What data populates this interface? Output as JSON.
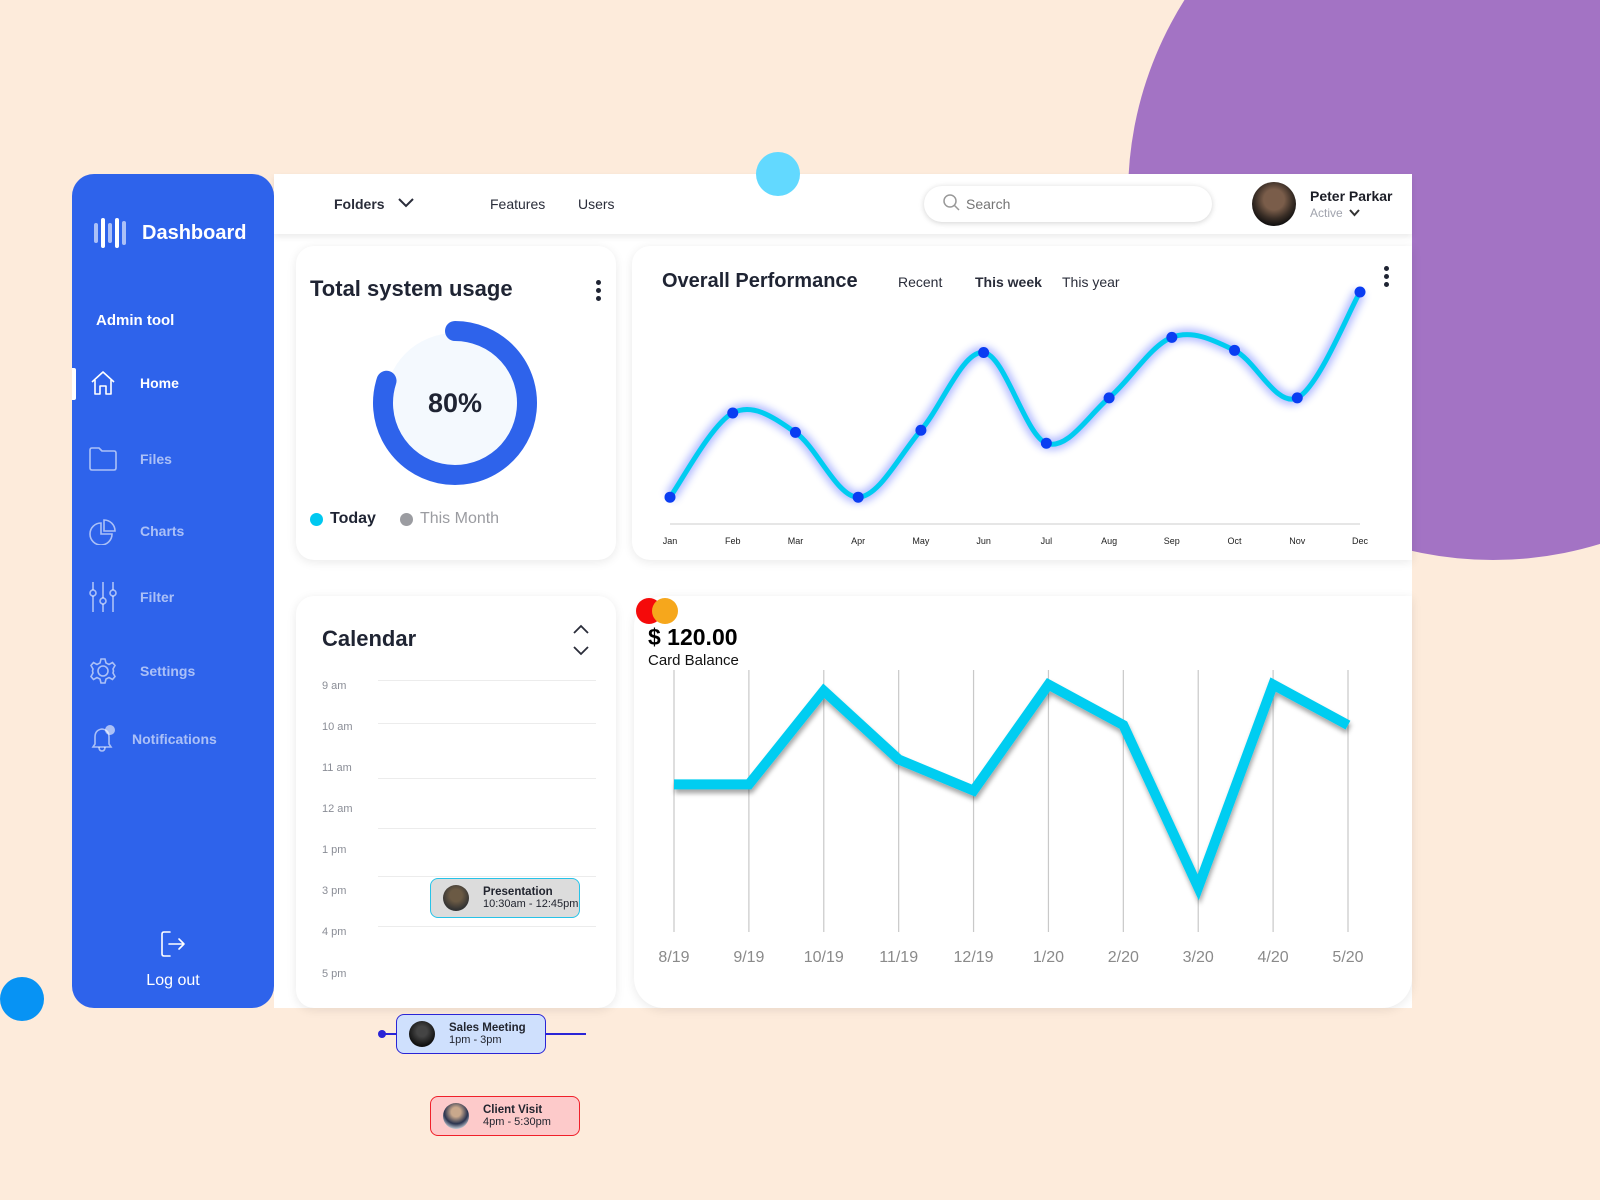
{
  "sidebar": {
    "brand_title": "Dashboard",
    "section_label": "Admin tool",
    "items": [
      {
        "label": "Home",
        "icon": "home-icon",
        "active": true
      },
      {
        "label": "Files",
        "icon": "folder-icon",
        "active": false
      },
      {
        "label": "Charts",
        "icon": "pie-chart-icon",
        "active": false
      },
      {
        "label": "Filter",
        "icon": "sliders-icon",
        "active": false
      },
      {
        "label": "Settings",
        "icon": "gear-icon",
        "active": false
      },
      {
        "label": "Notifications",
        "icon": "bell-icon",
        "active": false
      }
    ],
    "logout_label": "Log out"
  },
  "topbar": {
    "folders_label": "Folders",
    "features_label": "Features",
    "users_label": "Users",
    "search_placeholder": "Search",
    "search_value": "",
    "user_name": "Peter Parkar",
    "user_status": "Active"
  },
  "usage": {
    "title": "Total system usage",
    "percent_label": "80%",
    "percent": 80,
    "legend": [
      {
        "label": "Today",
        "color": "#00c8f0"
      },
      {
        "label": "This Month",
        "color": "#9b9ca1"
      }
    ]
  },
  "performance": {
    "title": "Overall Performance",
    "tabs": [
      {
        "label": "Recent",
        "active": false
      },
      {
        "label": "This week",
        "active": true
      },
      {
        "label": "This year",
        "active": false
      }
    ]
  },
  "calendar": {
    "title": "Calendar",
    "hours": [
      "9 am",
      "10 am",
      "11 am",
      "12 am",
      "1 pm",
      "3 pm",
      "4 pm",
      "5 pm"
    ],
    "events": [
      {
        "title": "Presentation",
        "time": "10:30am - 12:45pm",
        "color": "#dcdcdc",
        "border": "#27c3e8"
      },
      {
        "title": "Sales Meeting",
        "time": "1pm - 3pm",
        "color": "#cfe0fd",
        "border": "#2a24d6"
      },
      {
        "title": "Client Visit",
        "time": "4pm - 5:30pm",
        "color": "#fdcaca",
        "border": "#f0202a"
      }
    ]
  },
  "balance": {
    "amount": "$ 120.00",
    "label": "Card Balance"
  },
  "chart_data": [
    {
      "type": "line",
      "title": "Overall Performance",
      "categories": [
        "Jan",
        "Feb",
        "Mar",
        "Apr",
        "May",
        "Jun",
        "Jul",
        "Aug",
        "Sep",
        "Oct",
        "Nov",
        "Dec"
      ],
      "series": [
        {
          "name": "Performance",
          "values": [
            5,
            44,
            35,
            5,
            36,
            72,
            30,
            51,
            79,
            73,
            51,
            100
          ]
        }
      ],
      "xlabel": "",
      "ylabel": "",
      "ylim": [
        0,
        100
      ],
      "grid": false,
      "smooth": true,
      "line_color": "#00ccf0",
      "point_color": "#0a3df2"
    },
    {
      "type": "line",
      "title": "Card Balance",
      "categories": [
        "8/19",
        "9/19",
        "10/19",
        "11/19",
        "12/19",
        "1/20",
        "2/20",
        "3/20",
        "4/20",
        "5/20"
      ],
      "series": [
        {
          "name": "Balance",
          "values": [
            55,
            55,
            85,
            63,
            53,
            87,
            74,
            22,
            87,
            74
          ]
        }
      ],
      "xlabel": "",
      "ylabel": "",
      "ylim": [
        0,
        100
      ],
      "grid": "vertical",
      "line_color": "#00cdf1"
    }
  ]
}
